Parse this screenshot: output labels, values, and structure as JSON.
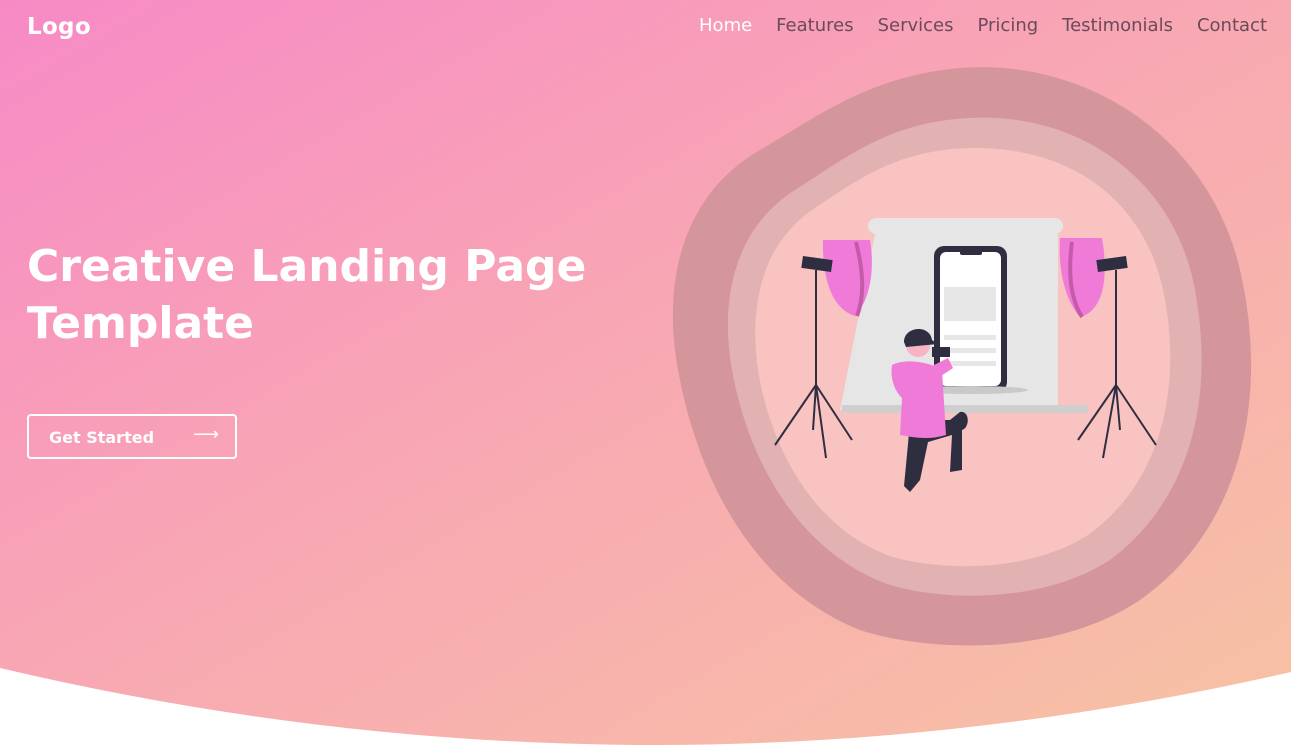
{
  "nav": {
    "logo": "Logo",
    "items": [
      {
        "label": "Home",
        "active": true
      },
      {
        "label": "Features",
        "active": false
      },
      {
        "label": "Services",
        "active": false
      },
      {
        "label": "Pricing",
        "active": false
      },
      {
        "label": "Testimonials",
        "active": false
      },
      {
        "label": "Contact",
        "active": false
      }
    ]
  },
  "hero": {
    "title_line1": "Creative Landing Page",
    "title_line2": "Template",
    "cta_label": "Get Started",
    "cta_icon": "long-arrow-right-icon"
  },
  "colors": {
    "gradient_start": "#f78ac6",
    "gradient_end": "#f7c3a3",
    "text_light": "#ffffff",
    "nav_text": "#6b4a5a",
    "illustration_accent": "#f07ad7",
    "illustration_dark": "#2f2e41"
  }
}
